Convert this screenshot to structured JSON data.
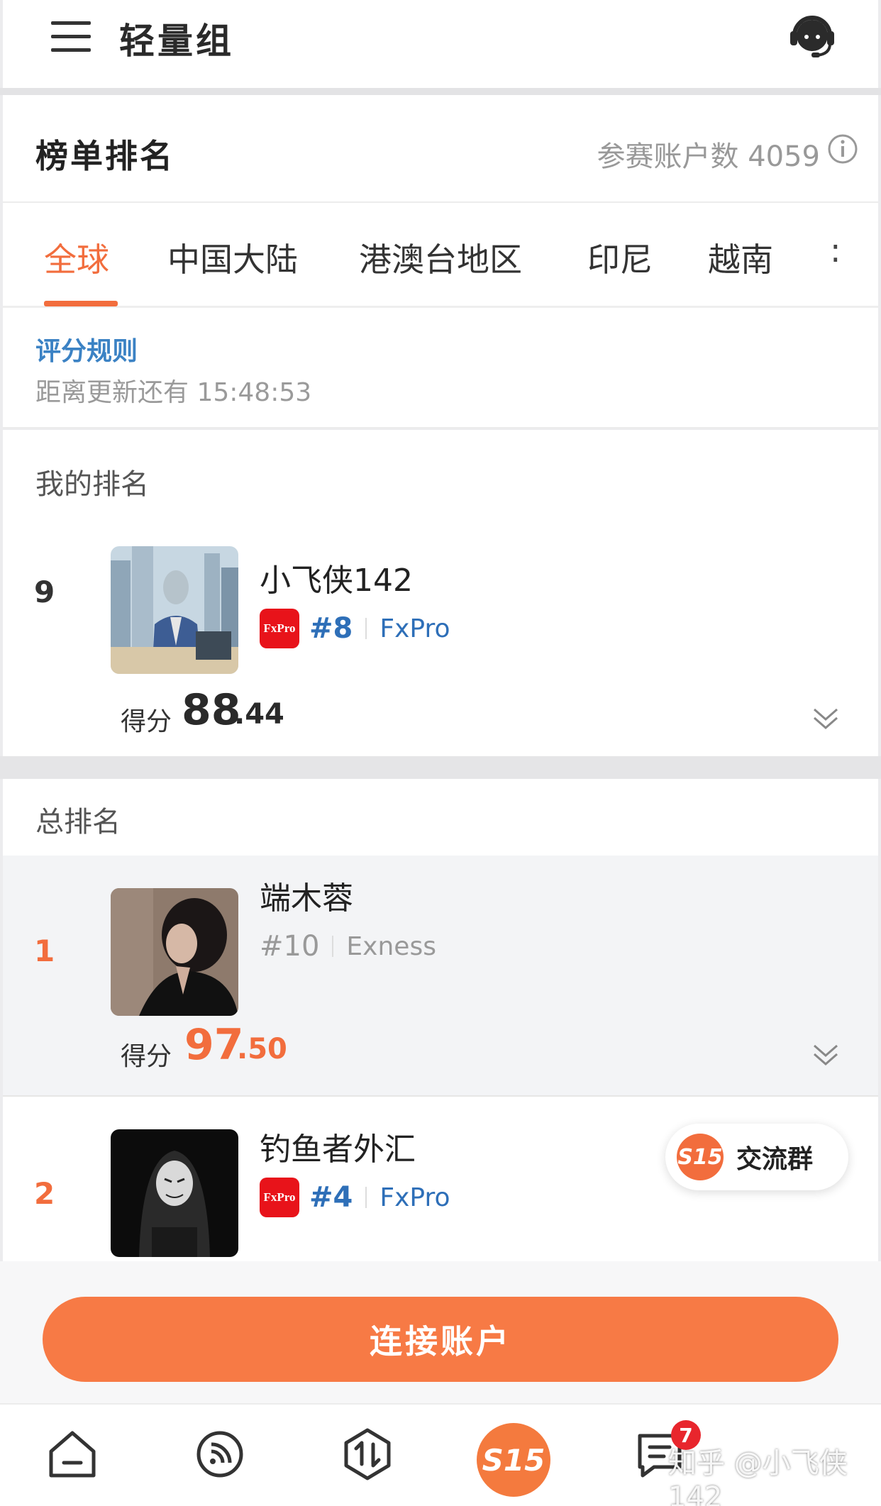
{
  "header": {
    "title": "轻量组",
    "menu_icon": "hamburger-icon",
    "support_icon": "headset-icon"
  },
  "leaderboard": {
    "title": "榜单排名",
    "participants_label": "参赛账户数 4059",
    "info_icon": "info-icon"
  },
  "tabs": [
    {
      "label": "全球",
      "active": true
    },
    {
      "label": "中国大陆",
      "active": false
    },
    {
      "label": "港澳台地区",
      "active": false
    },
    {
      "label": "印尼",
      "active": false
    },
    {
      "label": "越南",
      "active": false
    }
  ],
  "tab_more": ":",
  "rules": {
    "link": "评分规则",
    "countdown": "距离更新还有 15:48:53"
  },
  "my_ranking": {
    "title": "我的排名",
    "entry": {
      "rank": "9",
      "name": "小飞侠142",
      "broker_rank": "#8",
      "broker": "FxPro",
      "broker_logo_text": "FxPro",
      "score_label": "得分",
      "score_int": "88",
      "score_dec": ".44"
    }
  },
  "overall": {
    "title": "总排名",
    "entries": [
      {
        "rank": "1",
        "name": "端木蓉",
        "broker_rank": "#10",
        "broker": "Exness",
        "score_label": "得分",
        "score_int": "97",
        "score_dec": ".50"
      },
      {
        "rank": "2",
        "name": "钓鱼者外汇",
        "broker_rank": "#4",
        "broker": "FxPro",
        "broker_logo_text": "FxPro"
      }
    ]
  },
  "float_group": {
    "badge": "S15",
    "label": "交流群"
  },
  "connect_button": "连接账户",
  "bottom_nav": {
    "items": [
      "home-icon",
      "feed-icon",
      "trade-icon",
      "s15-icon",
      "messages-icon"
    ],
    "center_label": "S15",
    "message_badge": "7"
  },
  "watermark": "知乎 @小飞侠142",
  "colors": {
    "accent": "#f26d3d",
    "link": "#3b82c4",
    "broker_rank_blue": "#2e6fb8",
    "gray_text": "#9a9a9a"
  }
}
